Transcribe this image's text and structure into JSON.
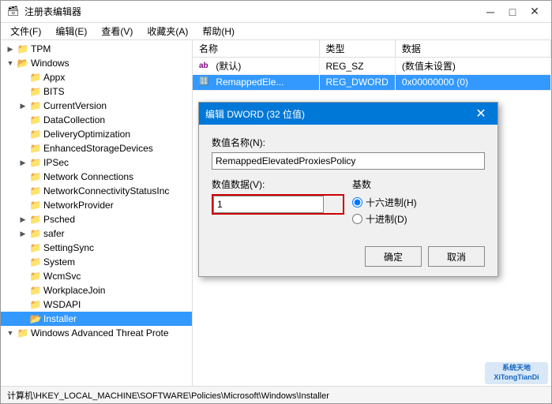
{
  "window": {
    "title": "注册表编辑器",
    "title_icon": "🗃",
    "minimize_label": "─",
    "maximize_label": "□",
    "close_label": "✕"
  },
  "menu": {
    "items": [
      {
        "label": "文件(F)"
      },
      {
        "label": "编辑(E)"
      },
      {
        "label": "查看(V)"
      },
      {
        "label": "收藏夹(A)"
      },
      {
        "label": "帮助(H)"
      }
    ]
  },
  "tree": {
    "items": [
      {
        "id": "tpm",
        "label": "TPM",
        "indent": "indent-1",
        "toggle": "▶",
        "has_toggle": true
      },
      {
        "id": "windows",
        "label": "Windows",
        "indent": "indent-1",
        "toggle": "▼",
        "has_toggle": true,
        "expanded": true
      },
      {
        "id": "appx",
        "label": "Appx",
        "indent": "indent-2",
        "toggle": "",
        "has_toggle": false
      },
      {
        "id": "bits",
        "label": "BITS",
        "indent": "indent-2",
        "toggle": "",
        "has_toggle": false
      },
      {
        "id": "currentversion",
        "label": "CurrentVersion",
        "indent": "indent-2",
        "toggle": "▶",
        "has_toggle": true
      },
      {
        "id": "datacollection",
        "label": "DataCollection",
        "indent": "indent-2",
        "toggle": "",
        "has_toggle": false
      },
      {
        "id": "deliveryoptimization",
        "label": "DeliveryOptimization",
        "indent": "indent-2",
        "toggle": "",
        "has_toggle": false
      },
      {
        "id": "enhancedstoragedevices",
        "label": "EnhancedStorageDevices",
        "indent": "indent-2",
        "toggle": "",
        "has_toggle": false
      },
      {
        "id": "ipsec",
        "label": "IPSec",
        "indent": "indent-2",
        "toggle": "▶",
        "has_toggle": true
      },
      {
        "id": "networkconnections",
        "label": "Network Connections",
        "indent": "indent-2",
        "toggle": "",
        "has_toggle": false
      },
      {
        "id": "networkconnectivitystatusinc",
        "label": "NetworkConnectivityStatusInc",
        "indent": "indent-2",
        "toggle": "",
        "has_toggle": false
      },
      {
        "id": "networkprovider",
        "label": "NetworkProvider",
        "indent": "indent-2",
        "toggle": "",
        "has_toggle": false
      },
      {
        "id": "psched",
        "label": "Psched",
        "indent": "indent-2",
        "toggle": "▶",
        "has_toggle": true
      },
      {
        "id": "safer",
        "label": "safer",
        "indent": "indent-2",
        "toggle": "▶",
        "has_toggle": true
      },
      {
        "id": "settingsync",
        "label": "SettingSync",
        "indent": "indent-2",
        "toggle": "",
        "has_toggle": false
      },
      {
        "id": "system",
        "label": "System",
        "indent": "indent-2",
        "toggle": "",
        "has_toggle": false
      },
      {
        "id": "wcmsvc",
        "label": "WcmSvc",
        "indent": "indent-2",
        "toggle": "",
        "has_toggle": false
      },
      {
        "id": "workplacejoin",
        "label": "WorkplaceJoin",
        "indent": "indent-2",
        "toggle": "",
        "has_toggle": false
      },
      {
        "id": "wsdapi",
        "label": "WSDAPI",
        "indent": "indent-2",
        "toggle": "",
        "has_toggle": false
      },
      {
        "id": "installer",
        "label": "Installer",
        "indent": "indent-2",
        "toggle": "",
        "has_toggle": false,
        "selected": true
      },
      {
        "id": "windowsadvancedthreatprote",
        "label": "Windows Advanced Threat Prote",
        "indent": "indent-1",
        "toggle": "▼",
        "has_toggle": true
      }
    ]
  },
  "table": {
    "columns": [
      {
        "label": "名称"
      },
      {
        "label": "类型"
      },
      {
        "label": "数据"
      }
    ],
    "rows": [
      {
        "name": "(默认)",
        "type": "REG_SZ",
        "data": "(数值未设置)",
        "icon": "ab",
        "selected": false
      },
      {
        "name": "RemappedEle...",
        "type": "REG_DWORD",
        "data": "0x00000000 (0)",
        "icon": "du",
        "selected": true
      }
    ]
  },
  "dialog": {
    "title": "编辑 DWORD (32 位值)",
    "close_label": "✕",
    "value_name_label": "数值名称(N):",
    "value_name": "RemappedElevatedProxiesPolicy",
    "value_data_label": "数值数据(V):",
    "value_data": "1",
    "base_label": "基数",
    "radio_hex_label": "● 十六进制(H)",
    "radio_dec_label": "○ 十进制(D)",
    "ok_label": "确定",
    "cancel_label": "取消"
  },
  "status_bar": {
    "path": "计算机\\HKEY_LOCAL_MACHINE\\SOFTWARE\\Policies\\Microsoft\\Windows\\Installer"
  },
  "watermark": {
    "text": "系统天地\nXiTongTianDi"
  }
}
